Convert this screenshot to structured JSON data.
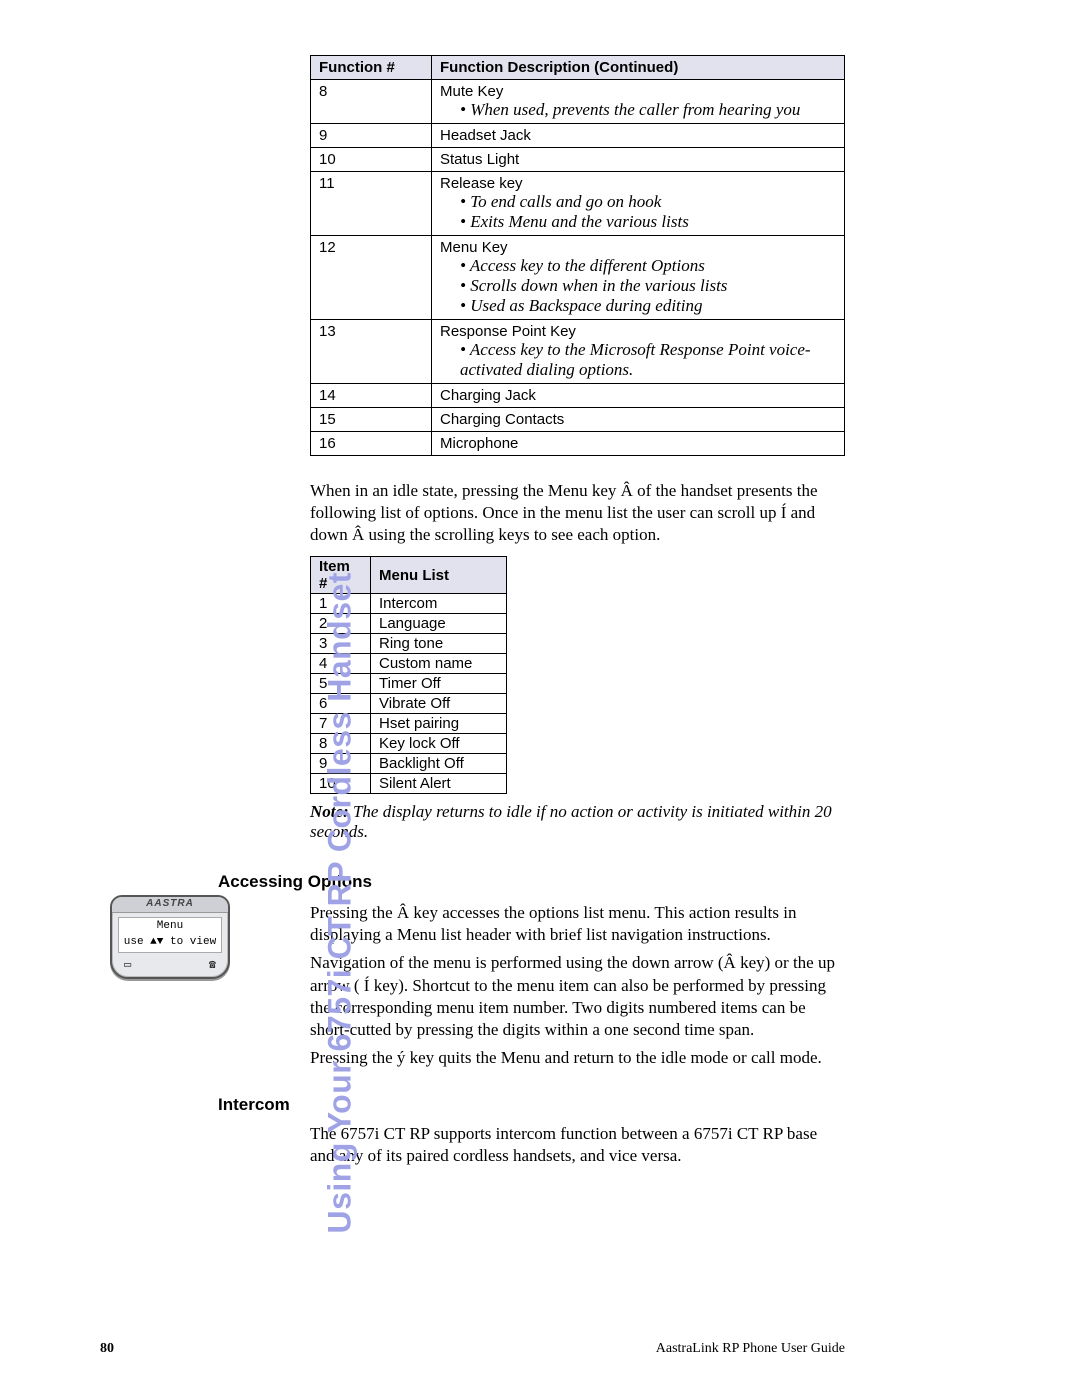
{
  "side_title": "Using Your 6757i CT RP Cordless Handset",
  "func_table": {
    "head1": "Function #",
    "head2": "Function Description (Continued)",
    "rows": [
      {
        "n": "8",
        "lines": [
          {
            "t": "plain",
            "v": "Mute Key"
          },
          {
            "t": "ital",
            "v": "• When used, prevents the caller from hearing you"
          }
        ]
      },
      {
        "n": "9",
        "lines": [
          {
            "t": "plain",
            "v": "Headset Jack"
          }
        ]
      },
      {
        "n": "10",
        "lines": [
          {
            "t": "plain",
            "v": "Status Light"
          }
        ]
      },
      {
        "n": "11",
        "lines": [
          {
            "t": "plain",
            "v": "Release key"
          },
          {
            "t": "ital",
            "v": "• To end calls and go on hook"
          },
          {
            "t": "ital",
            "v": "• Exits Menu and the various lists"
          }
        ]
      },
      {
        "n": "12",
        "lines": [
          {
            "t": "plain",
            "v": "Menu Key"
          },
          {
            "t": "ital",
            "v": "• Access key to the different Options"
          },
          {
            "t": "ital",
            "v": "• Scrolls down when in the various lists"
          },
          {
            "t": "ital",
            "v": "• Used as Backspace during editing"
          }
        ]
      },
      {
        "n": "13",
        "lines": [
          {
            "t": "plain",
            "v": "Response Point Key"
          },
          {
            "t": "ital",
            "v": "• Access key to the Microsoft Response Point voice-activated dialing options."
          }
        ]
      },
      {
        "n": "14",
        "lines": [
          {
            "t": "plain",
            "v": "Charging Jack"
          }
        ]
      },
      {
        "n": "15",
        "lines": [
          {
            "t": "plain",
            "v": "Charging Contacts"
          }
        ]
      },
      {
        "n": "16",
        "lines": [
          {
            "t": "plain",
            "v": "Microphone"
          }
        ]
      }
    ]
  },
  "para1": "When in an idle state, pressing the Menu key Â of the handset presents the following list of options. Once in the menu list the user can scroll up Í and down Â using the scrolling keys to see each option.",
  "menu_table": {
    "head1": "Item #",
    "head2": "Menu List",
    "rows": [
      {
        "n": "1",
        "v": "Intercom"
      },
      {
        "n": "2",
        "v": "Language"
      },
      {
        "n": "3",
        "v": "Ring tone"
      },
      {
        "n": "4",
        "v": "Custom name"
      },
      {
        "n": "5",
        "v": "Timer Off"
      },
      {
        "n": "6",
        "v": "Vibrate Off"
      },
      {
        "n": "7",
        "v": "Hset pairing"
      },
      {
        "n": "8",
        "v": "Key lock Off"
      },
      {
        "n": "9",
        "v": "Backlight Off"
      },
      {
        "n": "10",
        "v": "Silent Alert"
      }
    ]
  },
  "note_label": "Note:",
  "note_text": " The display returns to idle if no action or activity is initiated within 20 seconds.",
  "h_accessing": "Accessing Options",
  "acc_p1": "Pressing the Â key accesses the options list menu. This action results in displaying a Menu list header with brief list navigation instructions.",
  "acc_p2": "Navigation of the menu is performed using the down arrow (Â key) or the up arrow ( Í key). Shortcut to the menu item can also be performed by pressing the corresponding menu item number. Two digits numbered items can be short-cutted by pressing the digits within a one second time span.",
  "acc_p3": "Pressing the ý key quits the Menu and return to the idle mode or call mode.",
  "h_intercom": "Intercom",
  "int_p1": "The 6757i CT RP supports intercom function between a 6757i CT RP base and any of its paired cordless handsets, and vice versa.",
  "phone": {
    "brand": "AASTRA",
    "line1": "Menu",
    "line2": "use ▲▼ to view"
  },
  "footer": {
    "page": "80",
    "book": "AastraLink RP Phone User Guide"
  }
}
